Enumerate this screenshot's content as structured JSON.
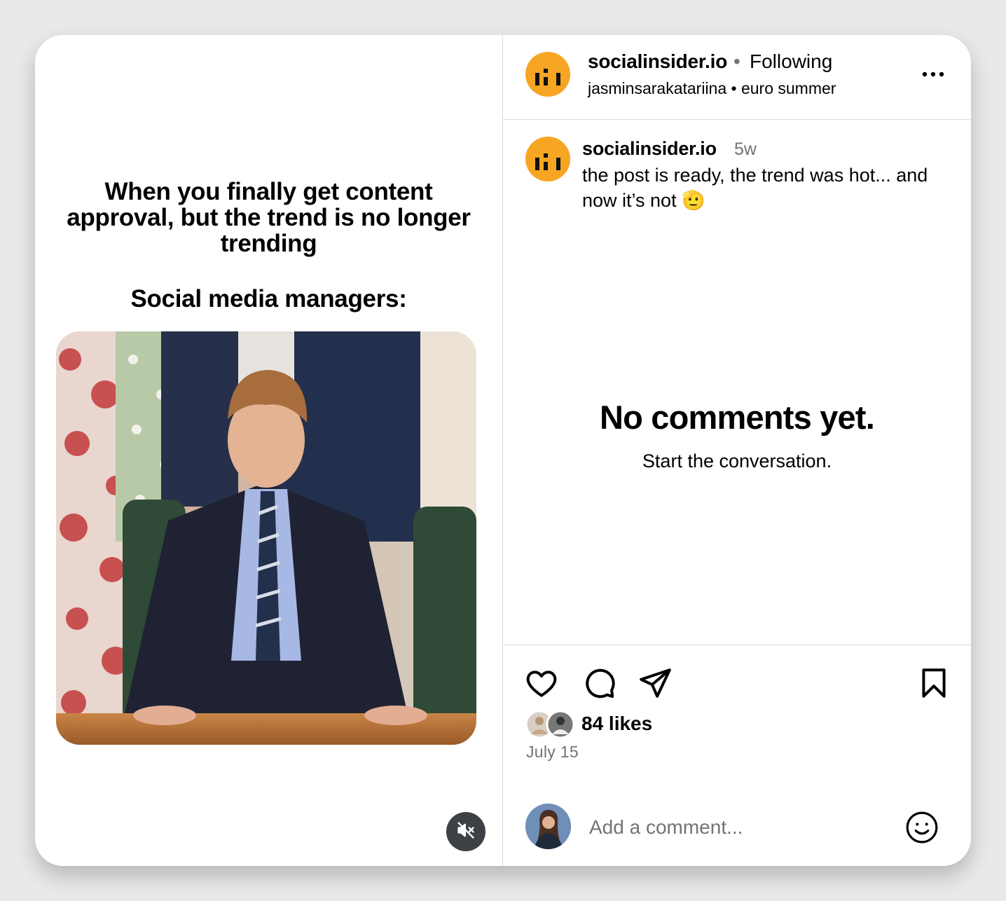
{
  "post": {
    "meme_top_text": "When you finally get content approval, but the trend is no longer trending",
    "meme_sub_text": "Social media managers:"
  },
  "header": {
    "username": "socialinsider.io",
    "separator": "•",
    "follow_status": "Following",
    "subline": "jasminsarakatariina • euro summer"
  },
  "caption": {
    "username": "socialinsider.io",
    "time": "5w",
    "text": "the post is ready, the trend was hot... and now it’s not 🫡"
  },
  "comments_empty": {
    "title": "No comments yet.",
    "subtitle": "Start the conversation."
  },
  "stats": {
    "likes": "84 likes",
    "date": "July 15"
  },
  "comment_box": {
    "placeholder": "Add a comment..."
  },
  "colors": {
    "brand_avatar": "#f7a623",
    "muted_text": "#737373",
    "divider": "#dbdbdb"
  },
  "icons": [
    "mute-icon",
    "more-icon",
    "heart-icon",
    "comment-icon",
    "share-icon",
    "bookmark-icon",
    "emoji-icon"
  ]
}
